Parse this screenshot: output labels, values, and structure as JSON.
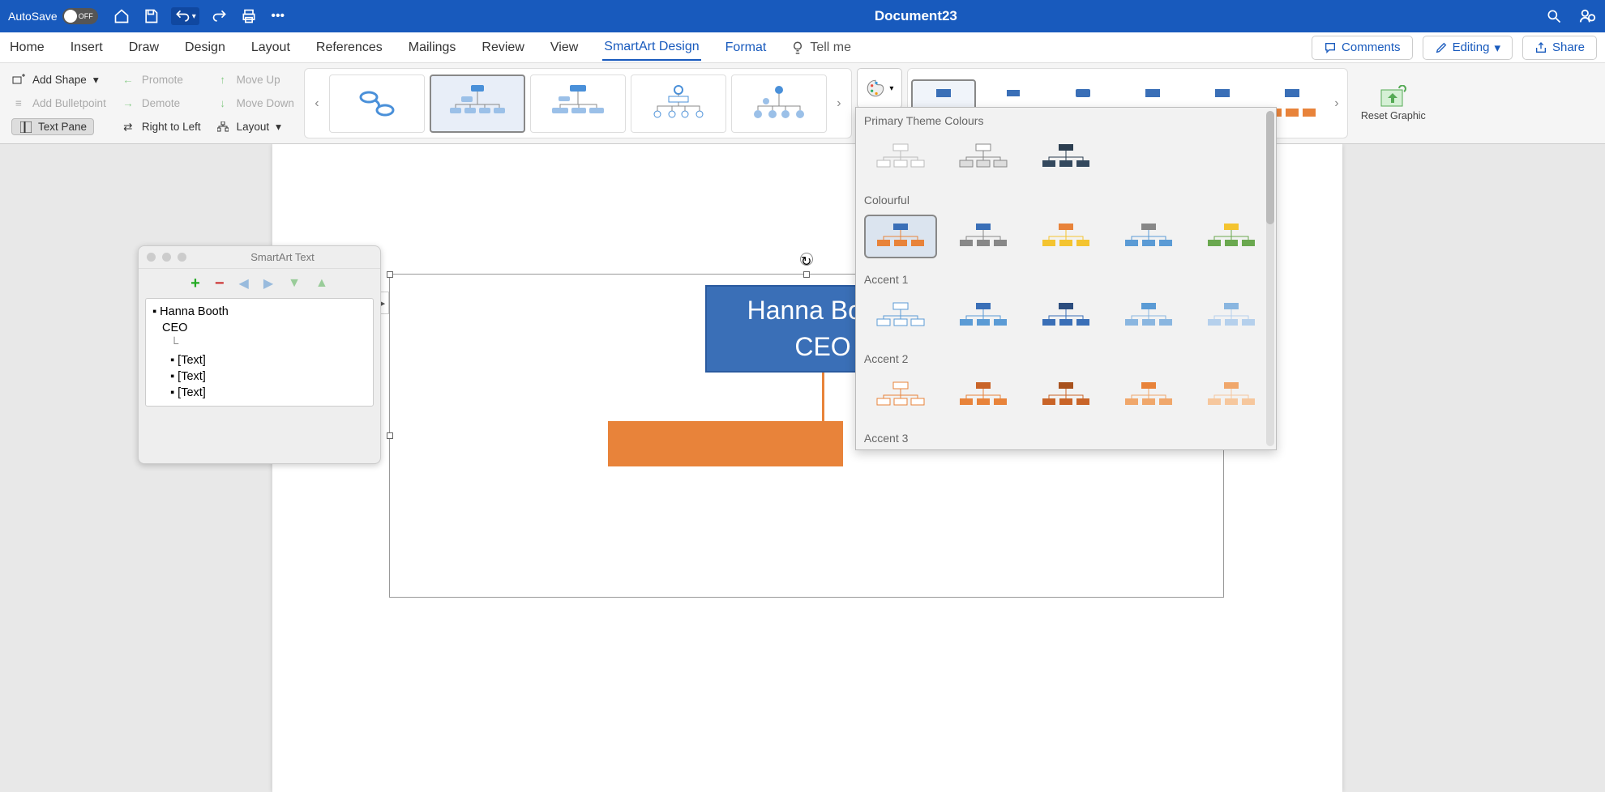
{
  "titlebar": {
    "autosave_label": "AutoSave",
    "autosave_state": "OFF",
    "document_title": "Document23"
  },
  "tabs": {
    "home": "Home",
    "insert": "Insert",
    "draw": "Draw",
    "design": "Design",
    "layout": "Layout",
    "references": "References",
    "mailings": "Mailings",
    "review": "Review",
    "view": "View",
    "smartart_design": "SmartArt Design",
    "format": "Format",
    "tell_me": "Tell me"
  },
  "actions": {
    "comments": "Comments",
    "editing": "Editing",
    "share": "Share"
  },
  "ribbon": {
    "add_shape": "Add Shape",
    "add_bulletpoint": "Add Bulletpoint",
    "text_pane": "Text Pane",
    "promote": "Promote",
    "demote": "Demote",
    "right_to_left": "Right to Left",
    "move_up": "Move Up",
    "move_down": "Move Down",
    "layout_menu": "Layout",
    "reset_graphic": "Reset Graphic"
  },
  "smartart": {
    "node_name": "Hanna Booth",
    "node_title": "CEO",
    "placeholder": "[Text]"
  },
  "textpane": {
    "title": "SmartArt Text",
    "items": [
      "Hanna Booth",
      "CEO",
      "[Text]",
      "[Text]",
      "[Text]"
    ]
  },
  "color_panel": {
    "primary_theme": "Primary Theme Colours",
    "colourful": "Colourful",
    "accent1": "Accent 1",
    "accent2": "Accent 2",
    "accent3": "Accent 3"
  }
}
